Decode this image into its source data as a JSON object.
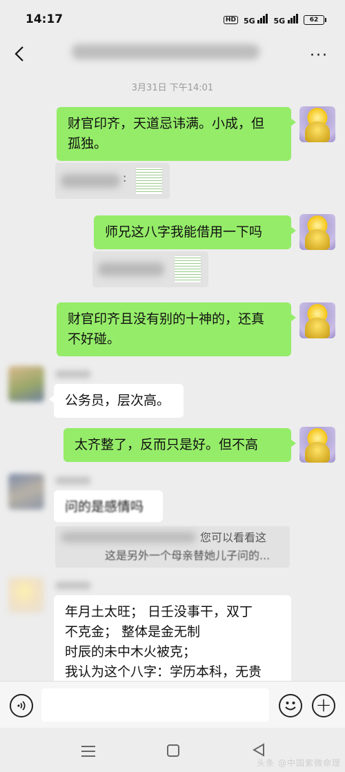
{
  "status_bar": {
    "time": "14:17",
    "hd": "HD",
    "net1": "5G",
    "net2": "5G",
    "battery": "62"
  },
  "header": {
    "more": "···"
  },
  "timestamp": "3月31日 下午14:01",
  "messages": [
    {
      "from": "me",
      "text_lines": [
        "财官印齐，天道忌讳满。小成，但",
        "孤独。"
      ]
    },
    {
      "from": "me",
      "type": "quote",
      "text": ":"
    },
    {
      "from": "me",
      "text_lines": [
        "师兄这八字我能借用一下吗"
      ]
    },
    {
      "from": "me",
      "type": "quote"
    },
    {
      "from": "me",
      "text_lines": [
        "财官印齐且没有别的十神的，还真",
        "不好碰。"
      ]
    },
    {
      "from": "other",
      "text_lines": [
        "公务员，层次高。"
      ]
    },
    {
      "from": "me",
      "text_lines": [
        "太齐整了，反而只是好。但不高"
      ]
    },
    {
      "from": "other",
      "text_lines": [
        "问的是感情吗"
      ]
    },
    {
      "from": "other",
      "type": "quote",
      "line1": "您可以看看这",
      "line2": "这是另外一个母亲替她儿子问的..."
    },
    {
      "from": "other",
      "text_lines": [
        "年月土太旺；  日壬没事干，双丁",
        "不克金；  整体是金无制",
        "时辰的未中木火被克；",
        "我认为这个八字：学历本科，无贵"
      ]
    }
  ],
  "watermark": "头条 @中国紫微命理",
  "colors": {
    "my_bubble": "#95ec69",
    "other_bubble": "#ffffff",
    "background": "#ededed"
  }
}
